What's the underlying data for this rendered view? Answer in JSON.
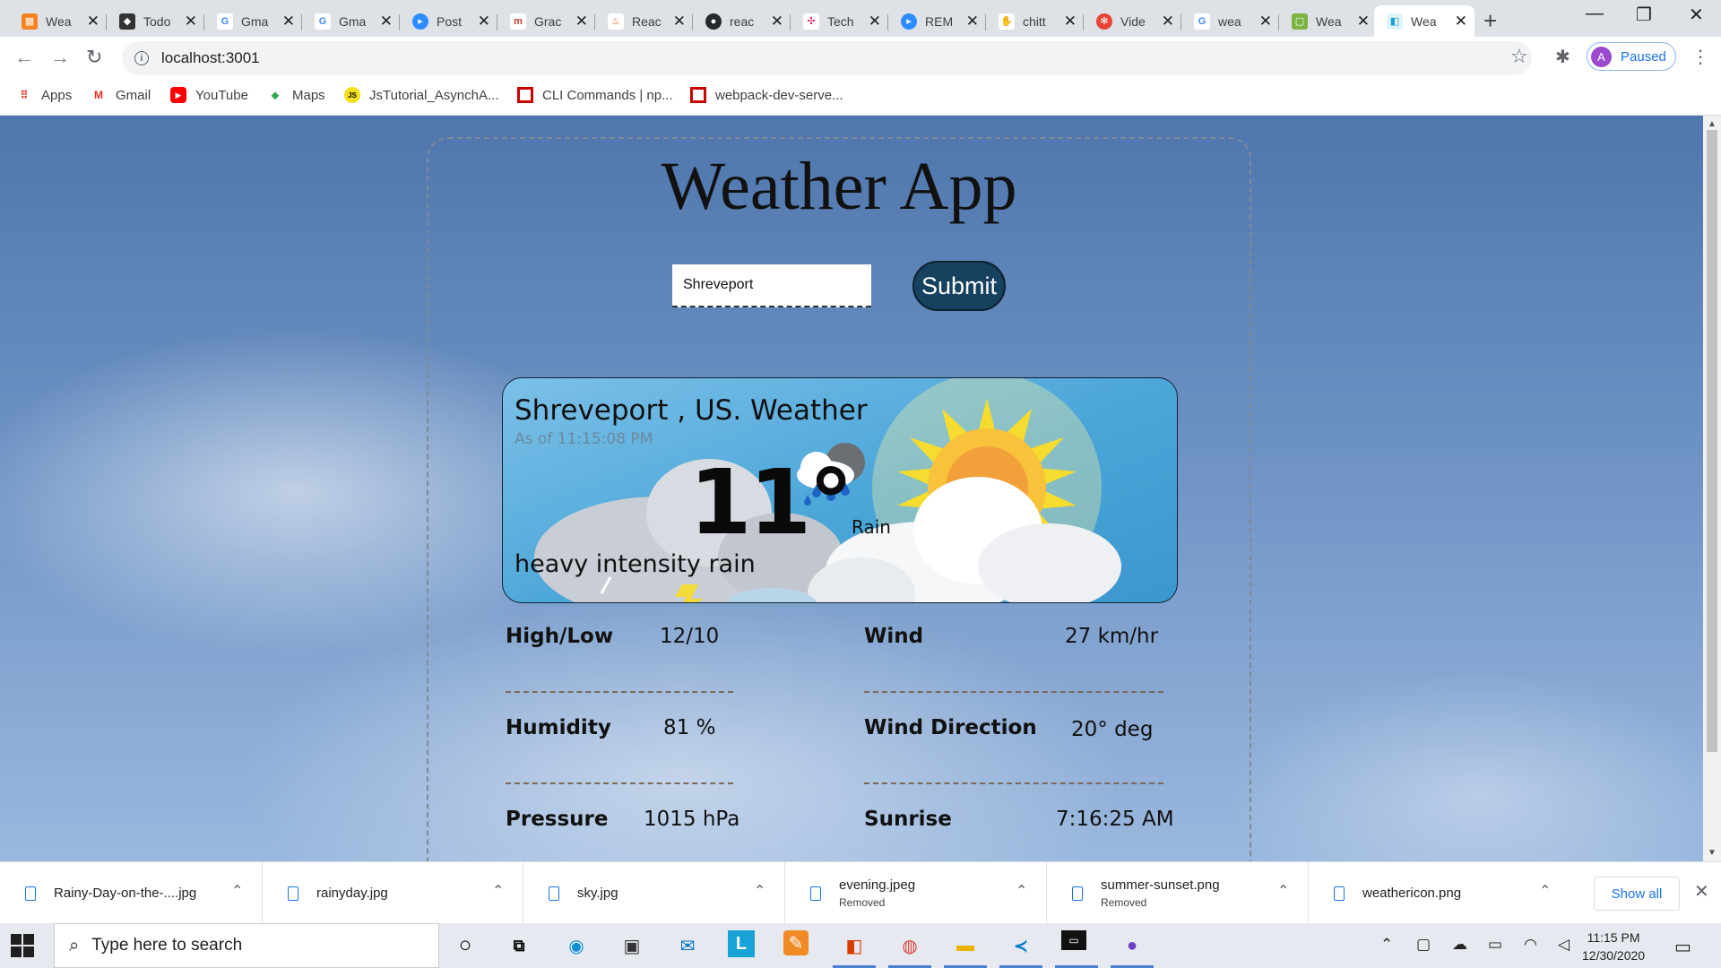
{
  "browser": {
    "tabs": [
      {
        "title": "Wea",
        "icon": "orange-grid-icon",
        "color": "#f58220"
      },
      {
        "title": "Todo",
        "icon": "cube-icon",
        "color": "#333333"
      },
      {
        "title": "Gma",
        "icon": "google-icon",
        "color": "#4285f4"
      },
      {
        "title": "Gma",
        "icon": "google-icon",
        "color": "#4285f4"
      },
      {
        "title": "Post",
        "icon": "zoom-icon",
        "color": "#2d8cff"
      },
      {
        "title": "Grac",
        "icon": "grace-icon",
        "color": "#c0392b"
      },
      {
        "title": "Reac",
        "icon": "flame-icon",
        "color": "#f4511e"
      },
      {
        "title": "reac",
        "icon": "github-icon",
        "color": "#24292e"
      },
      {
        "title": "Tech",
        "icon": "slack-icon",
        "color": "#e01e5a"
      },
      {
        "title": "REM",
        "icon": "zoom-icon",
        "color": "#2d8cff"
      },
      {
        "title": "chitt",
        "icon": "hand-icon",
        "color": "#f9a825"
      },
      {
        "title": "Vide",
        "icon": "pinwheel-icon",
        "color": "#ea4335"
      },
      {
        "title": "wea",
        "icon": "google-icon",
        "color": "#4285f4"
      },
      {
        "title": "Wea",
        "icon": "green-app-icon",
        "color": "#7cb342"
      },
      {
        "title": "Wea",
        "icon": "react-page-icon",
        "color": "#61dafb"
      }
    ],
    "url": "localhost:3001",
    "profile_initial": "A",
    "profile_label": "Paused",
    "bookmarks": [
      {
        "label": "Apps",
        "icon": "apps-grid-icon"
      },
      {
        "label": "Gmail",
        "icon": "gmail-icon"
      },
      {
        "label": "YouTube",
        "icon": "youtube-icon"
      },
      {
        "label": "Maps",
        "icon": "maps-icon"
      },
      {
        "label": "JsTutorial_AsynchA...",
        "icon": "js-icon"
      },
      {
        "label": "CLI Commands | np...",
        "icon": "npm-icon"
      },
      {
        "label": "webpack-dev-serve...",
        "icon": "npm-icon"
      }
    ]
  },
  "app": {
    "title": "Weather App",
    "search_value": "Shreveport",
    "submit_label": "Submit",
    "card": {
      "city": "Shreveport , US. Weather",
      "as_of": "As of 11:15:08 PM",
      "temp": "11°",
      "main": "Rain",
      "description": "heavy intensity rain"
    },
    "stats": [
      {
        "label": "High/Low",
        "value": "12/10"
      },
      {
        "label": "Wind",
        "value": "27 km/hr"
      },
      {
        "label": "Humidity",
        "value": "81 %"
      },
      {
        "label": "Wind Direction",
        "value": "20° deg"
      },
      {
        "label": "Pressure",
        "value": "1015 hPa"
      },
      {
        "label": "Sunrise",
        "value": "7:16:25 AM"
      }
    ]
  },
  "downloads": {
    "items": [
      {
        "name": "Rainy-Day-on-the-....jpg",
        "status": ""
      },
      {
        "name": "rainyday.jpg",
        "status": ""
      },
      {
        "name": "sky.jpg",
        "status": ""
      },
      {
        "name": "evening.jpeg",
        "status": "Removed"
      },
      {
        "name": "summer-sunset.png",
        "status": "Removed"
      },
      {
        "name": "weathericon.png",
        "status": ""
      }
    ],
    "show_all": "Show all"
  },
  "taskbar": {
    "search_placeholder": "Type here to search",
    "time": "11:15 PM",
    "date": "12/30/2020"
  }
}
